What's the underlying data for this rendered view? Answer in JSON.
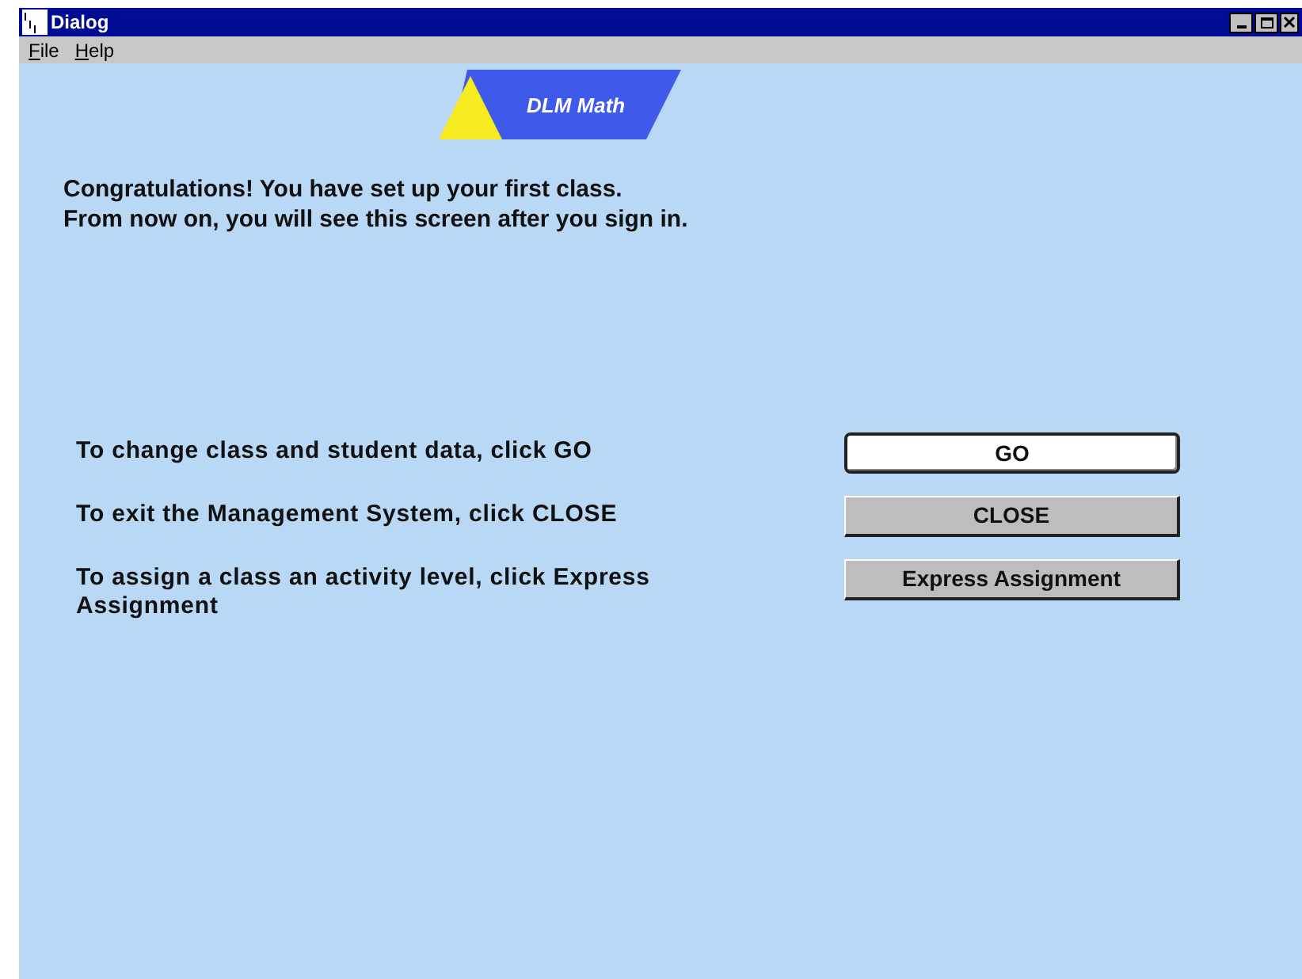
{
  "window": {
    "title": "Dialog"
  },
  "menu": [
    {
      "label": "File"
    },
    {
      "label": "Help"
    }
  ],
  "logo": {
    "text": "DLM Math"
  },
  "intro": [
    "Congratulations! You have set up your first class.",
    "From now on, you will see this screen after you sign in."
  ],
  "actions": [
    {
      "text": "To change class and student data, click GO",
      "button": "GO",
      "selected": true
    },
    {
      "text": "To exit the Management System, click CLOSE",
      "button": "CLOSE",
      "selected": false
    },
    {
      "text": "To assign a class an activity level, click Express Assignment",
      "button": "Express Assignment",
      "selected": false
    }
  ]
}
